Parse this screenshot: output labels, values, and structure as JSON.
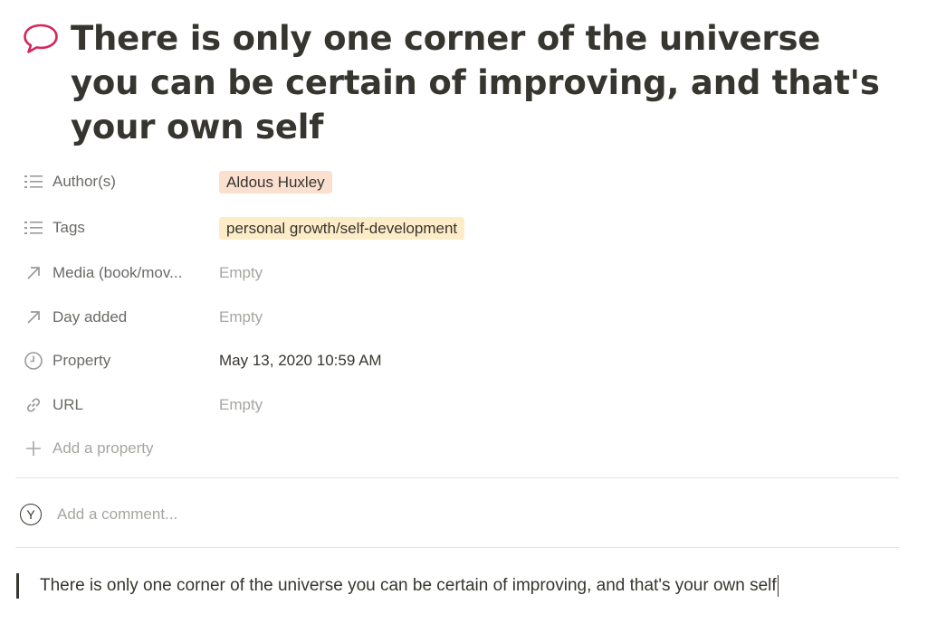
{
  "page": {
    "icon": "speech-bubble-icon",
    "title": "There is only one corner of the universe you can be certain of improving, and that's your own self"
  },
  "properties": [
    {
      "icon": "list-icon",
      "name": "Author(s)",
      "value": "Aldous Huxley",
      "type": "tag",
      "tag_color": "#fbe0d0"
    },
    {
      "icon": "list-icon",
      "name": "Tags",
      "value": "personal growth/self-development",
      "type": "tag",
      "tag_color": "#fdecc8"
    },
    {
      "icon": "arrow-up-right-icon",
      "name": "Media (book/mov...",
      "value": "Empty",
      "type": "empty"
    },
    {
      "icon": "arrow-up-right-icon",
      "name": "Day added",
      "value": "Empty",
      "type": "empty"
    },
    {
      "icon": "clock-icon",
      "name": "Property",
      "value": "May 13, 2020 10:59 AM",
      "type": "text"
    },
    {
      "icon": "link-icon",
      "name": "URL",
      "value": "Empty",
      "type": "empty"
    }
  ],
  "add_property": {
    "icon": "plus-icon",
    "label": "Add a property"
  },
  "comment": {
    "avatar_initial": "Y",
    "placeholder": "Add a comment..."
  },
  "body": {
    "quote_text": "There is only one corner of the universe you can be certain of improving, and that's your own self"
  },
  "colors": {
    "accent_icon": "#e03e6e",
    "text": "#37352f",
    "muted": "#a6a5a1",
    "divider": "#e5e4e1"
  }
}
